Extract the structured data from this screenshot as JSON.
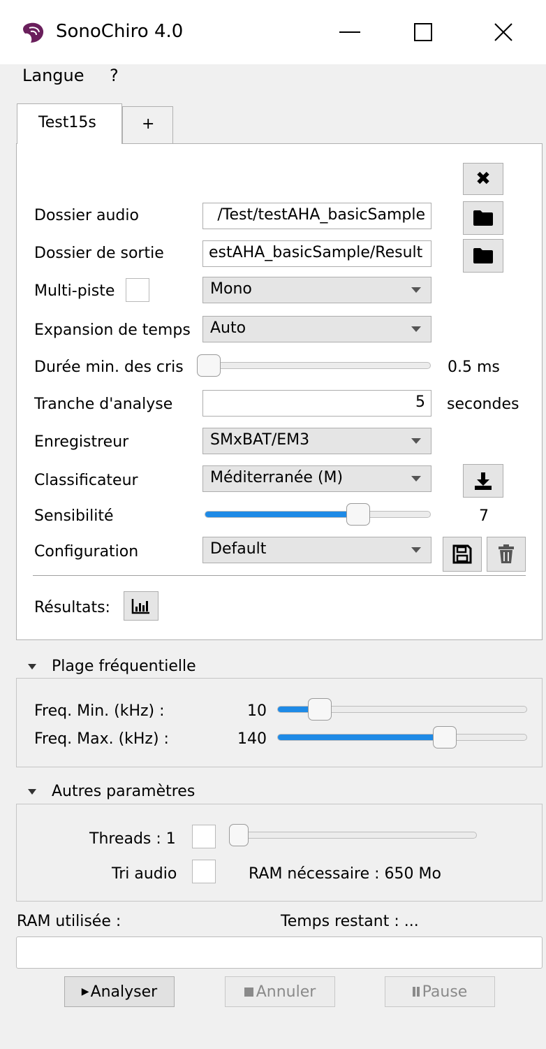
{
  "window": {
    "title": "SonoChiro 4.0",
    "app_icon": "bat-ear-icon",
    "controls": {
      "minimize": "minimize-icon",
      "maximize": "maximize-icon",
      "close": "×"
    }
  },
  "menu": {
    "items": [
      "Langue",
      "?"
    ]
  },
  "tabs": [
    {
      "label": "Test15s",
      "active": true
    },
    {
      "label": "+"
    }
  ],
  "form": {
    "close_tab_icon": "✖",
    "dossier_audio": {
      "label": "Dossier audio",
      "value": "/Test/testAHA_basicSample"
    },
    "dossier_sortie": {
      "label": "Dossier de sortie",
      "value": "estAHA_basicSample/Result"
    },
    "multi_piste": {
      "label": "Multi-piste",
      "checked": false,
      "select": "Mono"
    },
    "expansion": {
      "label": "Expansion de temps",
      "select": "Auto"
    },
    "duree": {
      "label": "Durée min. des cris",
      "value_text": "0.5 ms",
      "level": 0.02
    },
    "tranche": {
      "label": "Tranche d'analyse",
      "value": "5",
      "unit": "secondes"
    },
    "enregistreur": {
      "label": "Enregistreur",
      "select": "SMxBAT/EM3"
    },
    "classificateur": {
      "label": "Classificateur",
      "select": "Méditerranée (M)"
    },
    "sensibilite": {
      "label": "Sensibilité",
      "value_text": "7",
      "level": 0.68
    },
    "configuration": {
      "label": "Configuration",
      "select": "Default"
    },
    "resultats": {
      "label": "Résultats:"
    }
  },
  "plage": {
    "header": "Plage fréquentielle",
    "min": {
      "label": "Freq. Min. (kHz) :",
      "value": "10",
      "level": 0.17
    },
    "max": {
      "label": "Freq. Max. (kHz) :",
      "value": "140",
      "level": 0.67
    }
  },
  "autres": {
    "header": "Autres paramètres",
    "threads": {
      "label": "Threads : 1",
      "checked": false,
      "level": 0.0
    },
    "tri": {
      "label": "Tri audio",
      "checked": false
    },
    "ram_needed": "RAM nécessaire : 650 Mo"
  },
  "status": {
    "ram_used": "RAM utilisée :",
    "remaining": "Temps restant : ..."
  },
  "buttons": {
    "analyser": "Analyser",
    "annuler": "Annuler",
    "pause": "Pause"
  },
  "colors": {
    "accent": "#1e8ae6",
    "panel": "#ffffff",
    "window_bg": "#f0f0f0"
  }
}
